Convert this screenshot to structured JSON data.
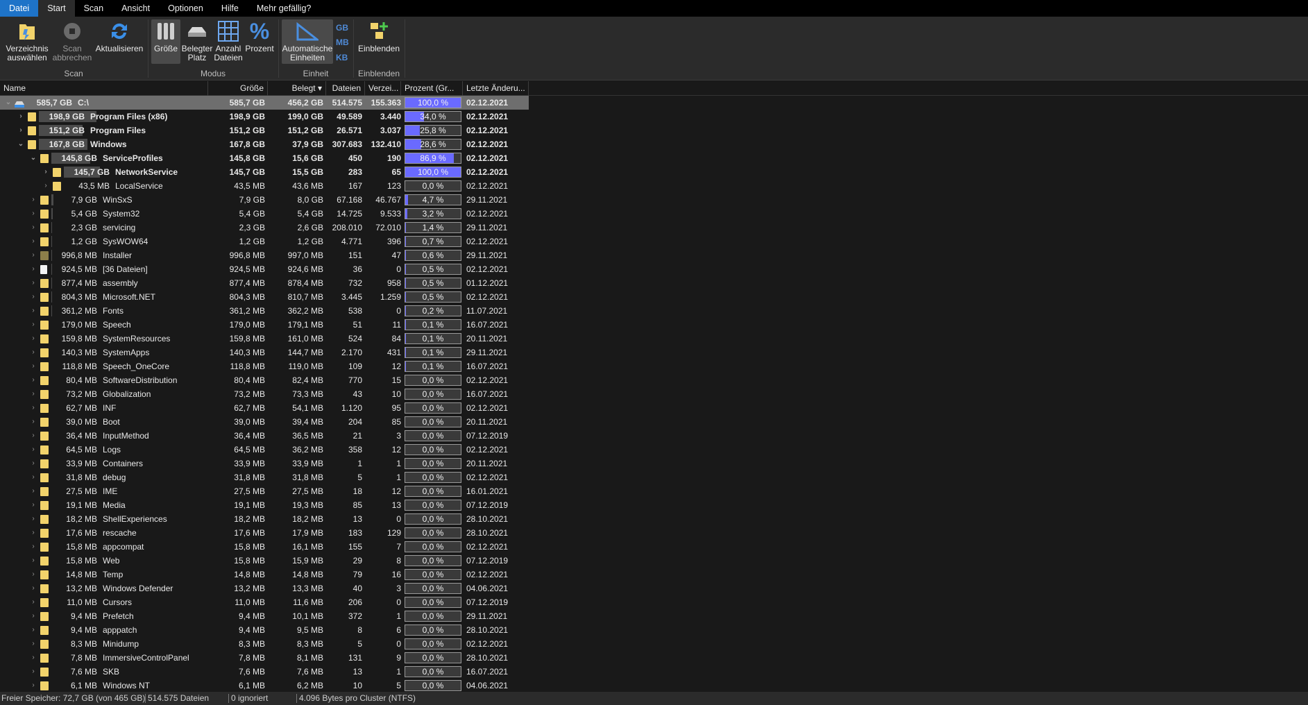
{
  "tabs": [
    "Datei",
    "Start",
    "Scan",
    "Ansicht",
    "Optionen",
    "Hilfe",
    "Mehr gefällig?"
  ],
  "ribbon": {
    "scan_group": "Scan",
    "modus_group": "Modus",
    "einheit_group": "Einheit",
    "einblenden_group": "Einblenden",
    "select_dir_1": "Verzeichnis",
    "select_dir_2": "auswählen",
    "stop_scan_1": "Scan",
    "stop_scan_2": "abbrechen",
    "refresh": "Aktualisieren",
    "size": "Größe",
    "used_space_1": "Belegter",
    "used_space_2": "Platz",
    "file_count_1": "Anzahl",
    "file_count_2": "Dateien",
    "percent": "Prozent",
    "auto_units_1": "Automatische",
    "auto_units_2": "Einheiten",
    "unit_gb": "GB",
    "unit_mb": "MB",
    "unit_kb": "KB",
    "show": "Einblenden"
  },
  "columns": [
    "Name",
    "Größe",
    "Belegt",
    "Dateien",
    "Verzei...",
    "Prozent (Gr...",
    "Letzte Änderu..."
  ],
  "rows": [
    {
      "size": "585,7 GB",
      "name": "C:\\",
      "size2": "585,7 GB",
      "used": "456,2 GB",
      "files": "514.575",
      "dirs": "155.363",
      "pct": "100,0 %",
      "pv": 100,
      "date": "02.12.2021",
      "lvl": 0,
      "exp": "open",
      "bold": true,
      "sel": true,
      "icon": "drive"
    },
    {
      "size": "198,9 GB",
      "name": "Program Files (x86)",
      "size2": "198,9 GB",
      "used": "199,0 GB",
      "files": "49.589",
      "dirs": "3.440",
      "pct": "34,0 %",
      "pv": 34,
      "date": "02.12.2021",
      "lvl": 1,
      "exp": "closed",
      "bold": true,
      "icon": "folder"
    },
    {
      "size": "151,2 GB",
      "name": "Program Files",
      "size2": "151,2 GB",
      "used": "151,2 GB",
      "files": "26.571",
      "dirs": "3.037",
      "pct": "25,8 %",
      "pv": 25.8,
      "date": "02.12.2021",
      "lvl": 1,
      "exp": "closed",
      "bold": true,
      "icon": "folder"
    },
    {
      "size": "167,8 GB",
      "name": "Windows",
      "size2": "167,8 GB",
      "used": "37,9 GB",
      "files": "307.683",
      "dirs": "132.410",
      "pct": "28,6 %",
      "pv": 28.6,
      "date": "02.12.2021",
      "lvl": 1,
      "exp": "open",
      "bold": true,
      "icon": "folder"
    },
    {
      "size": "145,8 GB",
      "name": "ServiceProfiles",
      "size2": "145,8 GB",
      "used": "15,6 GB",
      "files": "450",
      "dirs": "190",
      "pct": "86,9 %",
      "pv": 86.9,
      "date": "02.12.2021",
      "lvl": 2,
      "exp": "open",
      "bold": true,
      "icon": "folder"
    },
    {
      "size": "145,7 GB",
      "name": "NetworkService",
      "size2": "145,7 GB",
      "used": "15,5 GB",
      "files": "283",
      "dirs": "65",
      "pct": "100,0 %",
      "pv": 100,
      "date": "02.12.2021",
      "lvl": 3,
      "exp": "closed",
      "bold": true,
      "icon": "folder"
    },
    {
      "size": "43,5 MB",
      "name": "LocalService",
      "size2": "43,5 MB",
      "used": "43,6 MB",
      "files": "167",
      "dirs": "123",
      "pct": "0,0 %",
      "pv": 0,
      "date": "02.12.2021",
      "lvl": 3,
      "exp": "closed",
      "icon": "folder"
    },
    {
      "size": "7,9 GB",
      "name": "WinSxS",
      "size2": "7,9 GB",
      "used": "8,0 GB",
      "files": "67.168",
      "dirs": "46.767",
      "pct": "4,7 %",
      "pv": 4.7,
      "date": "29.11.2021",
      "lvl": 2,
      "exp": "closed",
      "icon": "folder"
    },
    {
      "size": "5,4 GB",
      "name": "System32",
      "size2": "5,4 GB",
      "used": "5,4 GB",
      "files": "14.725",
      "dirs": "9.533",
      "pct": "3,2 %",
      "pv": 3.2,
      "date": "02.12.2021",
      "lvl": 2,
      "exp": "closed",
      "icon": "folder"
    },
    {
      "size": "2,3 GB",
      "name": "servicing",
      "size2": "2,3 GB",
      "used": "2,6 GB",
      "files": "208.010",
      "dirs": "72.010",
      "pct": "1,4 %",
      "pv": 1.4,
      "date": "29.11.2021",
      "lvl": 2,
      "exp": "closed",
      "icon": "folder"
    },
    {
      "size": "1,2 GB",
      "name": "SysWOW64",
      "size2": "1,2 GB",
      "used": "1,2 GB",
      "files": "4.771",
      "dirs": "396",
      "pct": "0,7 %",
      "pv": 0.7,
      "date": "02.12.2021",
      "lvl": 2,
      "exp": "closed",
      "icon": "folder"
    },
    {
      "size": "996,8 MB",
      "name": "Installer",
      "size2": "996,8 MB",
      "used": "997,0 MB",
      "files": "151",
      "dirs": "47",
      "pct": "0,6 %",
      "pv": 0.6,
      "date": "29.11.2021",
      "lvl": 2,
      "exp": "closed",
      "icon": "folder-dark"
    },
    {
      "size": "924,5 MB",
      "name": "[36 Dateien]",
      "size2": "924,5 MB",
      "used": "924,6 MB",
      "files": "36",
      "dirs": "0",
      "pct": "0,5 %",
      "pv": 0.5,
      "date": "02.12.2021",
      "lvl": 2,
      "exp": "closed",
      "icon": "file"
    },
    {
      "size": "877,4 MB",
      "name": "assembly",
      "size2": "877,4 MB",
      "used": "878,4 MB",
      "files": "732",
      "dirs": "958",
      "pct": "0,5 %",
      "pv": 0.5,
      "date": "01.12.2021",
      "lvl": 2,
      "exp": "closed",
      "icon": "folder"
    },
    {
      "size": "804,3 MB",
      "name": "Microsoft.NET",
      "size2": "804,3 MB",
      "used": "810,7 MB",
      "files": "3.445",
      "dirs": "1.259",
      "pct": "0,5 %",
      "pv": 0.5,
      "date": "02.12.2021",
      "lvl": 2,
      "exp": "closed",
      "icon": "folder"
    },
    {
      "size": "361,2 MB",
      "name": "Fonts",
      "size2": "361,2 MB",
      "used": "362,2 MB",
      "files": "538",
      "dirs": "0",
      "pct": "0,2 %",
      "pv": 0.2,
      "date": "11.07.2021",
      "lvl": 2,
      "exp": "closed",
      "icon": "folder"
    },
    {
      "size": "179,0 MB",
      "name": "Speech",
      "size2": "179,0 MB",
      "used": "179,1 MB",
      "files": "51",
      "dirs": "11",
      "pct": "0,1 %",
      "pv": 0.1,
      "date": "16.07.2021",
      "lvl": 2,
      "exp": "closed",
      "icon": "folder"
    },
    {
      "size": "159,8 MB",
      "name": "SystemResources",
      "size2": "159,8 MB",
      "used": "161,0 MB",
      "files": "524",
      "dirs": "84",
      "pct": "0,1 %",
      "pv": 0.1,
      "date": "20.11.2021",
      "lvl": 2,
      "exp": "closed",
      "icon": "folder"
    },
    {
      "size": "140,3 MB",
      "name": "SystemApps",
      "size2": "140,3 MB",
      "used": "144,7 MB",
      "files": "2.170",
      "dirs": "431",
      "pct": "0,1 %",
      "pv": 0.1,
      "date": "29.11.2021",
      "lvl": 2,
      "exp": "closed",
      "icon": "folder"
    },
    {
      "size": "118,8 MB",
      "name": "Speech_OneCore",
      "size2": "118,8 MB",
      "used": "119,0 MB",
      "files": "109",
      "dirs": "12",
      "pct": "0,1 %",
      "pv": 0.1,
      "date": "16.07.2021",
      "lvl": 2,
      "exp": "closed",
      "icon": "folder"
    },
    {
      "size": "80,4 MB",
      "name": "SoftwareDistribution",
      "size2": "80,4 MB",
      "used": "82,4 MB",
      "files": "770",
      "dirs": "15",
      "pct": "0,0 %",
      "pv": 0,
      "date": "02.12.2021",
      "lvl": 2,
      "exp": "closed",
      "icon": "folder"
    },
    {
      "size": "73,2 MB",
      "name": "Globalization",
      "size2": "73,2 MB",
      "used": "73,3 MB",
      "files": "43",
      "dirs": "10",
      "pct": "0,0 %",
      "pv": 0,
      "date": "16.07.2021",
      "lvl": 2,
      "exp": "closed",
      "icon": "folder"
    },
    {
      "size": "62,7 MB",
      "name": "INF",
      "size2": "62,7 MB",
      "used": "54,1 MB",
      "files": "1.120",
      "dirs": "95",
      "pct": "0,0 %",
      "pv": 0,
      "date": "02.12.2021",
      "lvl": 2,
      "exp": "closed",
      "icon": "folder"
    },
    {
      "size": "39,0 MB",
      "name": "Boot",
      "size2": "39,0 MB",
      "used": "39,4 MB",
      "files": "204",
      "dirs": "85",
      "pct": "0,0 %",
      "pv": 0,
      "date": "20.11.2021",
      "lvl": 2,
      "exp": "closed",
      "icon": "folder"
    },
    {
      "size": "36,4 MB",
      "name": "InputMethod",
      "size2": "36,4 MB",
      "used": "36,5 MB",
      "files": "21",
      "dirs": "3",
      "pct": "0,0 %",
      "pv": 0,
      "date": "07.12.2019",
      "lvl": 2,
      "exp": "closed",
      "icon": "folder"
    },
    {
      "size": "64,5 MB",
      "name": "Logs",
      "size2": "64,5 MB",
      "used": "36,2 MB",
      "files": "358",
      "dirs": "12",
      "pct": "0,0 %",
      "pv": 0,
      "date": "02.12.2021",
      "lvl": 2,
      "exp": "closed",
      "icon": "folder"
    },
    {
      "size": "33,9 MB",
      "name": "Containers",
      "size2": "33,9 MB",
      "used": "33,9 MB",
      "files": "1",
      "dirs": "1",
      "pct": "0,0 %",
      "pv": 0,
      "date": "20.11.2021",
      "lvl": 2,
      "exp": "closed",
      "icon": "folder"
    },
    {
      "size": "31,8 MB",
      "name": "debug",
      "size2": "31,8 MB",
      "used": "31,8 MB",
      "files": "5",
      "dirs": "1",
      "pct": "0,0 %",
      "pv": 0,
      "date": "02.12.2021",
      "lvl": 2,
      "exp": "closed",
      "icon": "folder"
    },
    {
      "size": "27,5 MB",
      "name": "IME",
      "size2": "27,5 MB",
      "used": "27,5 MB",
      "files": "18",
      "dirs": "12",
      "pct": "0,0 %",
      "pv": 0,
      "date": "16.01.2021",
      "lvl": 2,
      "exp": "closed",
      "icon": "folder"
    },
    {
      "size": "19,1 MB",
      "name": "Media",
      "size2": "19,1 MB",
      "used": "19,3 MB",
      "files": "85",
      "dirs": "13",
      "pct": "0,0 %",
      "pv": 0,
      "date": "07.12.2019",
      "lvl": 2,
      "exp": "closed",
      "icon": "folder"
    },
    {
      "size": "18,2 MB",
      "name": "ShellExperiences",
      "size2": "18,2 MB",
      "used": "18,2 MB",
      "files": "13",
      "dirs": "0",
      "pct": "0,0 %",
      "pv": 0,
      "date": "28.10.2021",
      "lvl": 2,
      "exp": "closed",
      "icon": "folder"
    },
    {
      "size": "17,6 MB",
      "name": "rescache",
      "size2": "17,6 MB",
      "used": "17,9 MB",
      "files": "183",
      "dirs": "129",
      "pct": "0,0 %",
      "pv": 0,
      "date": "28.10.2021",
      "lvl": 2,
      "exp": "closed",
      "icon": "folder"
    },
    {
      "size": "15,8 MB",
      "name": "appcompat",
      "size2": "15,8 MB",
      "used": "16,1 MB",
      "files": "155",
      "dirs": "7",
      "pct": "0,0 %",
      "pv": 0,
      "date": "02.12.2021",
      "lvl": 2,
      "exp": "closed",
      "icon": "folder"
    },
    {
      "size": "15,8 MB",
      "name": "Web",
      "size2": "15,8 MB",
      "used": "15,9 MB",
      "files": "29",
      "dirs": "8",
      "pct": "0,0 %",
      "pv": 0,
      "date": "07.12.2019",
      "lvl": 2,
      "exp": "closed",
      "icon": "folder"
    },
    {
      "size": "14,8 MB",
      "name": "Temp",
      "size2": "14,8 MB",
      "used": "14,8 MB",
      "files": "79",
      "dirs": "16",
      "pct": "0,0 %",
      "pv": 0,
      "date": "02.12.2021",
      "lvl": 2,
      "exp": "closed",
      "icon": "folder"
    },
    {
      "size": "13,2 MB",
      "name": "Windows Defender",
      "size2": "13,2 MB",
      "used": "13,3 MB",
      "files": "40",
      "dirs": "3",
      "pct": "0,0 %",
      "pv": 0,
      "date": "04.06.2021",
      "lvl": 2,
      "exp": "closed",
      "icon": "folder"
    },
    {
      "size": "11,0 MB",
      "name": "Cursors",
      "size2": "11,0 MB",
      "used": "11,6 MB",
      "files": "206",
      "dirs": "0",
      "pct": "0,0 %",
      "pv": 0,
      "date": "07.12.2019",
      "lvl": 2,
      "exp": "closed",
      "icon": "folder"
    },
    {
      "size": "9,4 MB",
      "name": "Prefetch",
      "size2": "9,4 MB",
      "used": "10,1 MB",
      "files": "372",
      "dirs": "1",
      "pct": "0,0 %",
      "pv": 0,
      "date": "29.11.2021",
      "lvl": 2,
      "exp": "closed",
      "icon": "folder"
    },
    {
      "size": "9,4 MB",
      "name": "apppatch",
      "size2": "9,4 MB",
      "used": "9,5 MB",
      "files": "8",
      "dirs": "6",
      "pct": "0,0 %",
      "pv": 0,
      "date": "28.10.2021",
      "lvl": 2,
      "exp": "closed",
      "icon": "folder"
    },
    {
      "size": "8,3 MB",
      "name": "Minidump",
      "size2": "8,3 MB",
      "used": "8,3 MB",
      "files": "5",
      "dirs": "0",
      "pct": "0,0 %",
      "pv": 0,
      "date": "02.12.2021",
      "lvl": 2,
      "exp": "closed",
      "icon": "folder"
    },
    {
      "size": "7,8 MB",
      "name": "ImmersiveControlPanel",
      "size2": "7,8 MB",
      "used": "8,1 MB",
      "files": "131",
      "dirs": "9",
      "pct": "0,0 %",
      "pv": 0,
      "date": "28.10.2021",
      "lvl": 2,
      "exp": "closed",
      "icon": "folder"
    },
    {
      "size": "7,6 MB",
      "name": "SKB",
      "size2": "7,6 MB",
      "used": "7,6 MB",
      "files": "13",
      "dirs": "1",
      "pct": "0,0 %",
      "pv": 0,
      "date": "16.07.2021",
      "lvl": 2,
      "exp": "closed",
      "icon": "folder"
    },
    {
      "size": "6,1 MB",
      "name": "Windows NT",
      "size2": "6,1 MB",
      "used": "6,2 MB",
      "files": "10",
      "dirs": "5",
      "pct": "0,0 %",
      "pv": 0,
      "date": "04.06.2021",
      "lvl": 2,
      "exp": "closed",
      "icon": "folder"
    }
  ],
  "status": {
    "free": "Freier Speicher: 72,7 GB  (von 465 GB)",
    "files": "514.575 Dateien",
    "ignored": "0 ignoriert",
    "cluster": "4.096 Bytes pro Cluster (NTFS)"
  },
  "colors": {
    "accent": "#1e73c8",
    "percent_fill": "#6a6aff",
    "folder": "#f2d36b"
  }
}
